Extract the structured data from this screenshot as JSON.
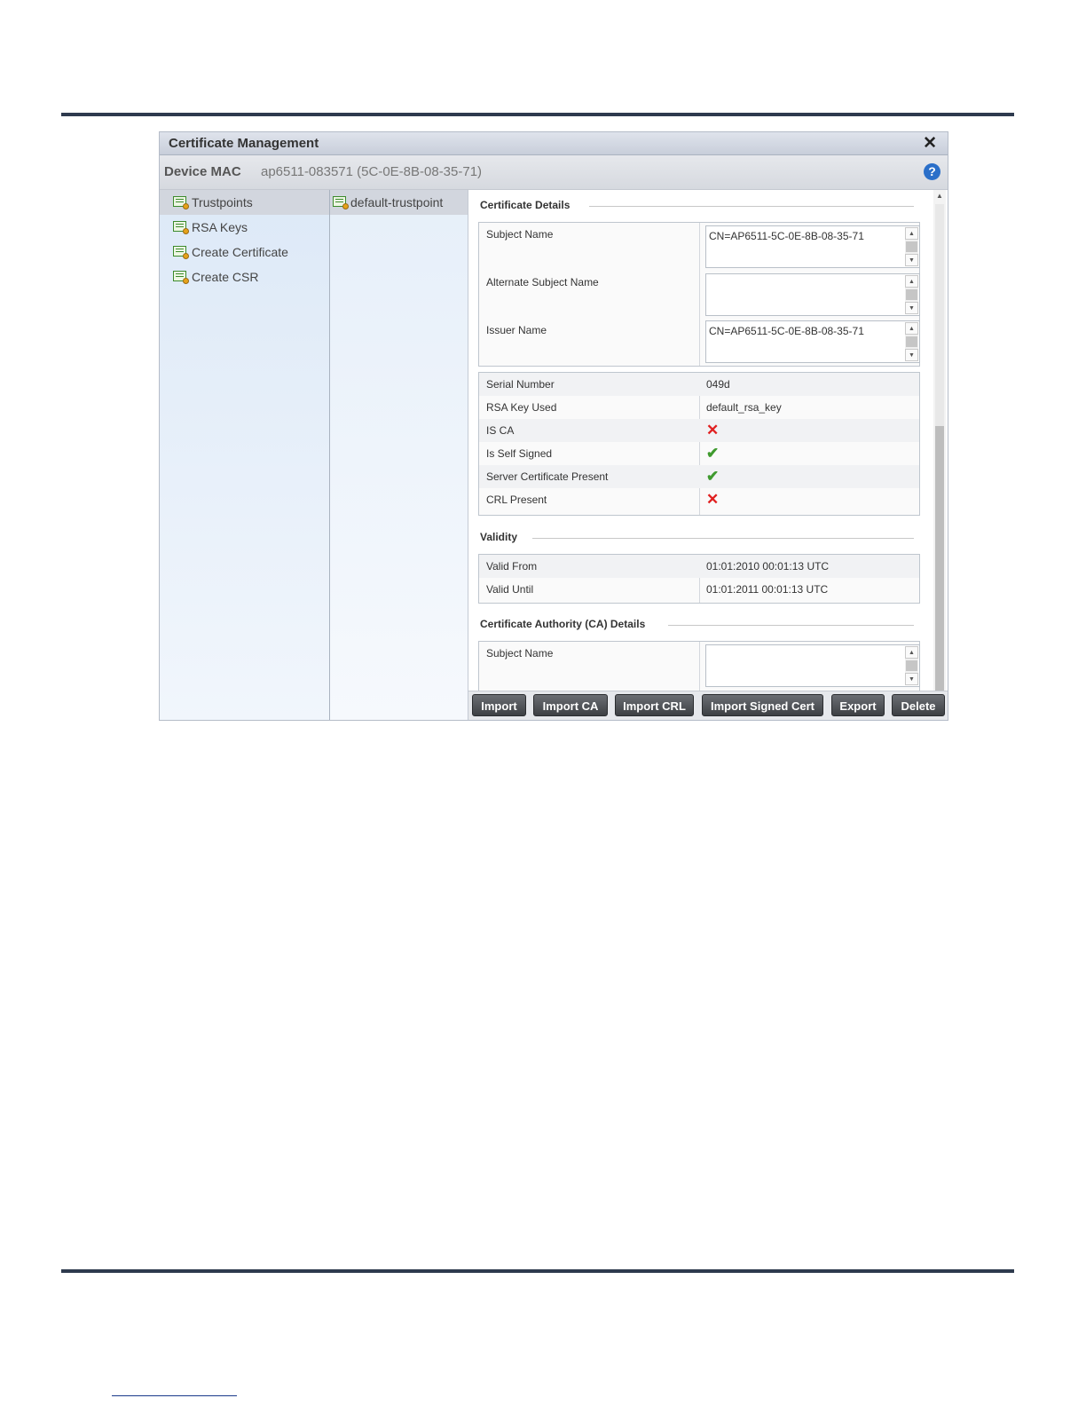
{
  "dialog": {
    "title": "Certificate Management",
    "close_glyph": "✕",
    "device_mac_label": "Device MAC",
    "device_mac_value": "ap6511-083571 (5C-0E-8B-08-35-71)",
    "help_glyph": "?"
  },
  "nav": {
    "items": [
      {
        "label": "Trustpoints",
        "icon": "certificate-icon",
        "selected": true
      },
      {
        "label": "RSA Keys",
        "icon": "certificate-icon"
      },
      {
        "label": "Create Certificate",
        "icon": "certificate-icon"
      },
      {
        "label": "Create CSR",
        "icon": "certificate-icon"
      }
    ]
  },
  "trustpoints": {
    "items": [
      {
        "label": "default-trustpoint",
        "icon": "certificate-icon",
        "selected": true
      }
    ]
  },
  "certificate_details": {
    "heading": "Certificate Details",
    "subject_name_label": "Subject Name",
    "subject_name_value": "CN=AP6511-5C-0E-8B-08-35-71",
    "alt_subject_name_label": "Alternate Subject Name",
    "alt_subject_name_value": "",
    "issuer_name_label": "Issuer Name",
    "issuer_name_value": "CN=AP6511-5C-0E-8B-08-35-71",
    "rows": [
      {
        "label": "Serial Number",
        "value": "049d"
      },
      {
        "label": "RSA Key Used",
        "value": "default_rsa_key"
      },
      {
        "label": "IS CA",
        "value": "✕",
        "status": "false"
      },
      {
        "label": "Is Self Signed",
        "value": "✔",
        "status": "true"
      },
      {
        "label": "Server Certificate Present",
        "value": "✔",
        "status": "true"
      },
      {
        "label": "CRL Present",
        "value": "✕",
        "status": "false"
      }
    ]
  },
  "validity": {
    "heading": "Validity",
    "rows": [
      {
        "label": "Valid From",
        "value": "01:01:2010 00:01:13 UTC"
      },
      {
        "label": "Valid Until",
        "value": "01:01:2011 00:01:13 UTC"
      }
    ]
  },
  "ca_details": {
    "heading": "Certificate Authority (CA) Details",
    "subject_name_label": "Subject Name",
    "subject_name_value": ""
  },
  "scroll_glyphs": {
    "up": "▲",
    "down": "▼"
  },
  "buttons": {
    "import": "Import",
    "import_ca": "Import CA",
    "import_crl": "Import CRL",
    "import_signed_cert": "Import Signed Cert",
    "export": "Export",
    "delete": "Delete"
  },
  "colors": {
    "accent": "#2a6fc9",
    "status_false": "#e02020",
    "status_true": "#3f9a2e"
  }
}
